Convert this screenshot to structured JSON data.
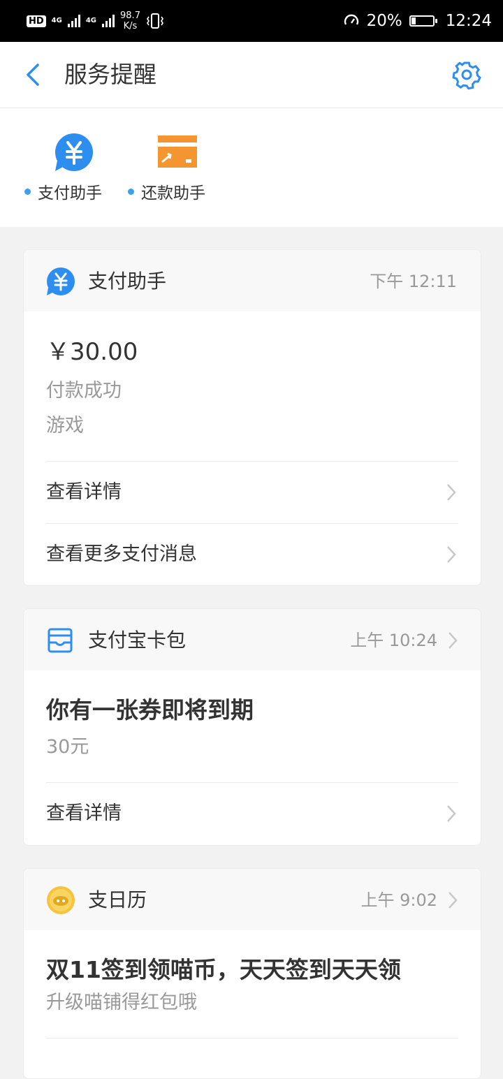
{
  "status_bar": {
    "hd": "HD",
    "net1": "4G",
    "net2": "4G",
    "speed_value": "98.7",
    "speed_unit": "K/s",
    "battery_percent": "20%",
    "battery_level": 0.2,
    "time": "12:24"
  },
  "nav": {
    "title": "服务提醒"
  },
  "assistants": [
    {
      "label": "支付助手",
      "icon": "yuan-bubble-icon",
      "color": "#2e8ef0"
    },
    {
      "label": "还款助手",
      "icon": "card-arrow-icon",
      "color": "#f3962f"
    }
  ],
  "cards": {
    "payment": {
      "title": "支付助手",
      "time": "下午 12:11",
      "amount": "￥30.00",
      "status": "付款成功",
      "category": "游戏",
      "rows": [
        "查看详情",
        "查看更多支付消息"
      ]
    },
    "wallet": {
      "title": "支付宝卡包",
      "time": "上午 10:24",
      "headline": "你有一张券即将到期",
      "detail": "30元",
      "rows": [
        "查看详情"
      ]
    },
    "calendar": {
      "title": "支日历",
      "time": "上午 9:02",
      "headline": "双11签到领喵币，天天签到天天领",
      "detail": "升级喵铺得红包哦"
    }
  },
  "colors": {
    "accent_blue": "#2e8ef0",
    "orange": "#f3962f",
    "gold": "#f5c43a"
  }
}
